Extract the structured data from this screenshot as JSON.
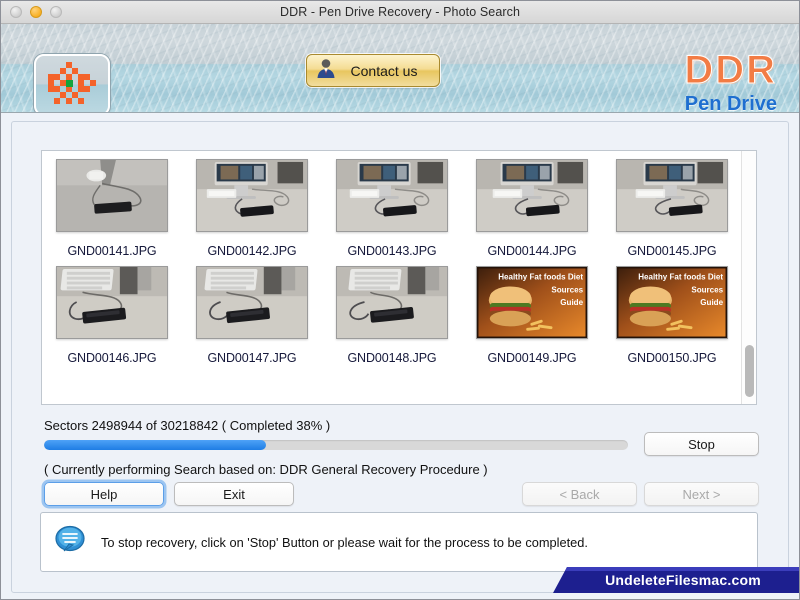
{
  "window": {
    "title": "DDR - Pen Drive Recovery - Photo Search",
    "traffic_lights": [
      "close-disabled",
      "minimize-active",
      "zoom-disabled"
    ]
  },
  "header": {
    "logo_name": "ddr-checker-logo",
    "contact_button": {
      "label": "Contact us",
      "icon": "person-icon"
    },
    "brand": {
      "title": "DDR",
      "subtitle": "Pen Drive",
      "title_color": "#f27c45",
      "subtitle_color": "#1f6fd0"
    }
  },
  "files": {
    "items": [
      {
        "name": "GND00141.JPG",
        "thumb": "desk-drive-1"
      },
      {
        "name": "GND00142.JPG",
        "thumb": "imac-desk-1"
      },
      {
        "name": "GND00143.JPG",
        "thumb": "imac-desk-2"
      },
      {
        "name": "GND00144.JPG",
        "thumb": "imac-desk-3"
      },
      {
        "name": "GND00145.JPG",
        "thumb": "imac-desk-4"
      },
      {
        "name": "GND00146.JPG",
        "thumb": "keyboard-drive-1"
      },
      {
        "name": "GND00147.JPG",
        "thumb": "keyboard-drive-2"
      },
      {
        "name": "GND00148.JPG",
        "thumb": "keyboard-drive-3"
      },
      {
        "name": "GND00149.JPG",
        "thumb": "burger-diet-banner"
      },
      {
        "name": "GND00150.JPG",
        "thumb": "burger-diet-banner"
      }
    ],
    "banner_text": {
      "line1": "Healthy Fat  foods Diet",
      "line2": "Sources",
      "line3": "Guide"
    }
  },
  "progress": {
    "sectors_text": "Sectors 2498944 of 30218842   ( Completed 38% )",
    "percent": 38,
    "bar_color": "#2e86ef",
    "status_text": "( Currently performing Search based on: DDR General Recovery Procedure )"
  },
  "buttons": {
    "stop": {
      "label": "Stop",
      "disabled": false
    },
    "help": {
      "label": "Help",
      "disabled": false,
      "focused": true
    },
    "exit": {
      "label": "Exit",
      "disabled": false
    },
    "back": {
      "label": "< Back",
      "disabled": true
    },
    "next": {
      "label": "Next >",
      "disabled": true
    }
  },
  "hint": {
    "icon": "speech-bubble-icon",
    "text": "To stop recovery, click on 'Stop' Button or please wait for the process to be completed."
  },
  "watermark": {
    "text": "UndeleteFilesmac.com",
    "color": "#1d1f8f"
  }
}
